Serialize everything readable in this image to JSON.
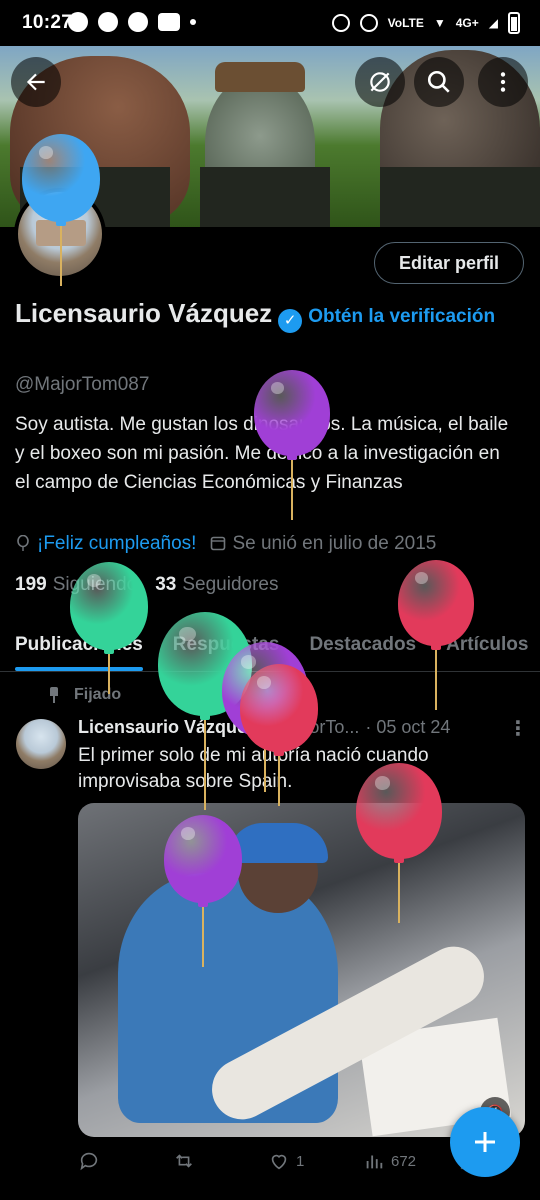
{
  "status_bar": {
    "time": "10:27",
    "network": "4G+"
  },
  "header": {
    "back_icon": "arrow-left-icon",
    "sync_icon": "sync-icon",
    "search_icon": "search-icon",
    "more_icon": "more-vertical-icon"
  },
  "profile": {
    "edit_button": "Editar perfil",
    "display_name": "Licensaurio Vázquez",
    "get_verified": "Obtén la verificación",
    "handle": "@MajorTom087",
    "bio": "Soy autista. Me gustan los dinosaurios. La música, el baile y el boxeo son mi pasión. Me dedico a la investigación en el campo de Ciencias Económicas y Finanzas",
    "birthday": "¡Feliz cumpleaños!",
    "joined": "Se unió en julio de 2015",
    "following_count": "199",
    "following_label": "Siguiendo",
    "followers_count": "33",
    "followers_label": "Seguidores"
  },
  "tabs": [
    {
      "label": "Publicaciones"
    },
    {
      "label": "Respuestas"
    },
    {
      "label": "Destacados"
    },
    {
      "label": "Artículos"
    }
  ],
  "post": {
    "pinned_label": "Fijado",
    "author_name": "Licensaurio Vázquez",
    "author_handle": "@MajorTo...",
    "date": "· 05 oct 24",
    "text": "El primer solo de mi autoría nació cuando improvisaba sobre Spain.",
    "likes": "1",
    "views": "672"
  },
  "colors": {
    "accent": "#1d9bf0",
    "background": "#000000",
    "muted": "#71767b",
    "balloon_blue": "#3ea6f2",
    "balloon_purple": "#a03fd6",
    "balloon_green": "#34d399",
    "balloon_red": "#e23a5b"
  }
}
